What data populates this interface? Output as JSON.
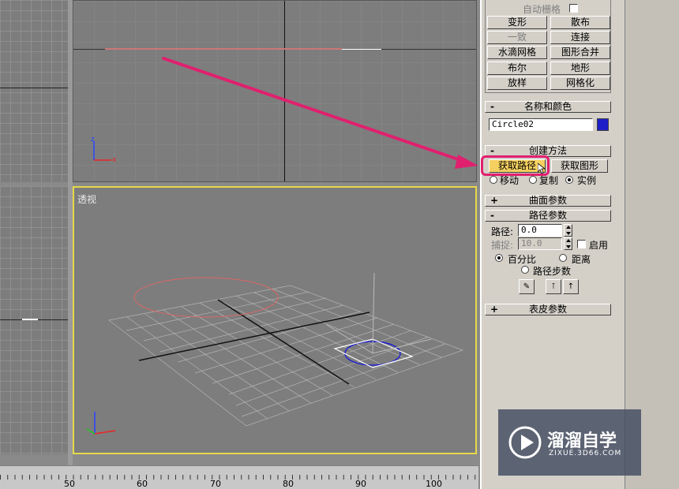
{
  "viewports": {
    "perspective_label": "透视"
  },
  "command_panel": {
    "auto_grid_label": "自动栅格",
    "object_types": [
      {
        "label": "变形",
        "enabled": true
      },
      {
        "label": "散布",
        "enabled": true
      },
      {
        "label": "一致",
        "enabled": false
      },
      {
        "label": "连接",
        "enabled": true
      },
      {
        "label": "水滴网格",
        "enabled": true
      },
      {
        "label": "图形合并",
        "enabled": true
      },
      {
        "label": "布尔",
        "enabled": true
      },
      {
        "label": "地形",
        "enabled": true
      },
      {
        "label": "放样",
        "enabled": true
      },
      {
        "label": "网格化",
        "enabled": true
      }
    ],
    "name_color": {
      "rollout_title": "名称和颜色",
      "rollout_sign": "-",
      "object_name": "Circle02",
      "swatch_color": "#1f1fc8"
    },
    "creation_method": {
      "rollout_title": "创建方法",
      "rollout_sign": "-",
      "get_path": "获取路径",
      "get_shape": "获取图形",
      "move": "移动",
      "copy": "复制",
      "instance": "实例",
      "selected": "instance"
    },
    "surface_params": {
      "rollout_title": "曲面参数",
      "rollout_sign": "+"
    },
    "path_params": {
      "rollout_title": "路径参数",
      "rollout_sign": "-",
      "path_label": "路径:",
      "path_value": "0.0",
      "snap_label": "捕捉:",
      "snap_value": "10.0",
      "enable_label": "启用",
      "percentage": "百分比",
      "distance": "距离",
      "path_steps": "路径步数",
      "selected": "percentage"
    },
    "skin_params": {
      "rollout_title": "表皮参数",
      "rollout_sign": "+"
    }
  },
  "timeline": {
    "ticks": [
      "50",
      "60",
      "70",
      "80",
      "90",
      "100"
    ]
  },
  "watermark": {
    "brand": "溜溜自学",
    "url": "ZIXUE.3D66.COM"
  },
  "colors": {
    "highlight": "#e0206e",
    "active_viewport_border": "#e6d84a"
  }
}
